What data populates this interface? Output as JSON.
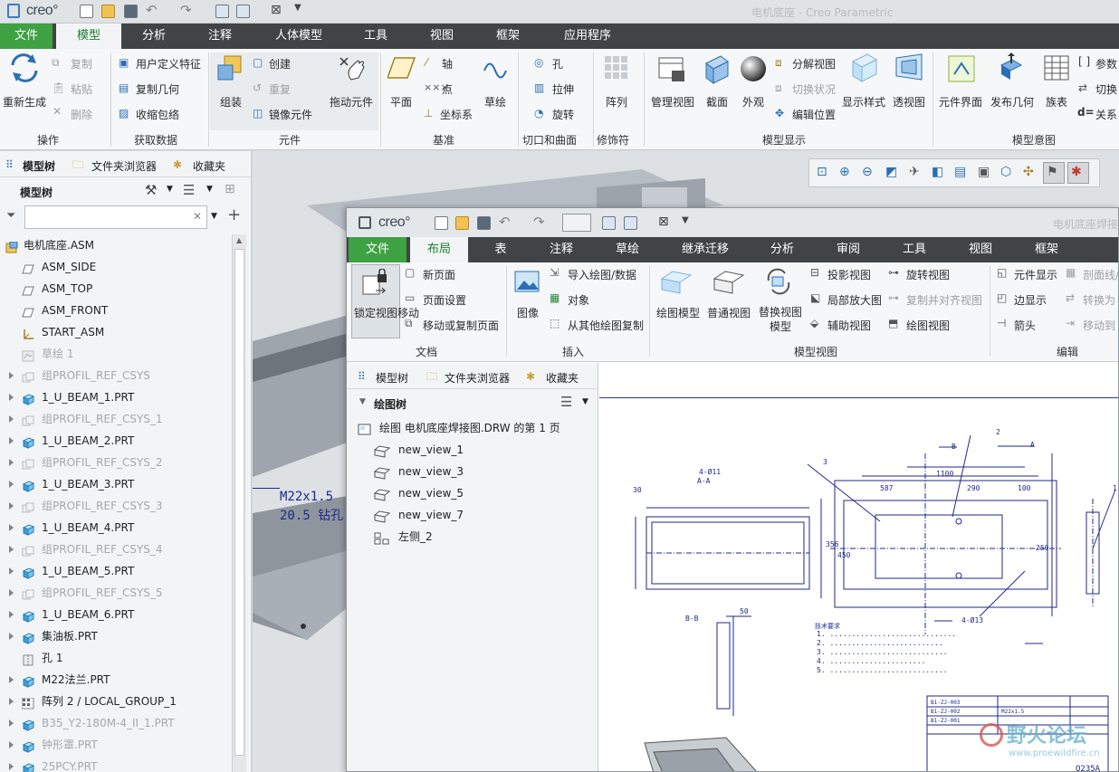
{
  "main": {
    "logo": "creo°",
    "window_title": "电机底座 - Creo Parametric",
    "tabs": [
      "文件",
      "模型",
      "分析",
      "注释",
      "人体模型",
      "工具",
      "视图",
      "框架",
      "应用程序"
    ],
    "ribbon": {
      "regen": "重新生成",
      "copy": "复制",
      "paste": "粘贴",
      "delete": "删除",
      "group_ops": "操作",
      "udf": "用户定义特征",
      "copy_geom": "复制几何",
      "shrinkwrap": "收缩包络",
      "group_getdata": "获取数据",
      "assemble": "组装",
      "create": "创建",
      "repeat": "重复",
      "mirror": "镜像元件",
      "drag": "拖动元件",
      "group_component": "元件",
      "plane": "平面",
      "axis": "轴",
      "point": "点",
      "csys": "坐标系",
      "sketch": "草绘",
      "group_datum": "基准",
      "hole": "孔",
      "extrude": "拉伸",
      "revolve": "旋转",
      "group_cut": "切口和曲面",
      "pattern": "阵列",
      "group_modifier": "修饰符",
      "manage_views": "管理视图",
      "section": "截面",
      "appearance": "外观",
      "explode": "分解视图",
      "toggle_status": "切换状况",
      "edit_position": "编辑位置",
      "display_style": "显示样式",
      "perspective": "透视图",
      "group_display": "模型显示",
      "comp_interface": "元件界面",
      "publish_geom": "发布几何",
      "family_table": "族表",
      "params": "参数",
      "switch": "切换",
      "relations": "关系",
      "group_intent": "模型意图"
    },
    "panel": {
      "tab_tree": "模型树",
      "tab_folder": "文件夹浏览器",
      "tab_fav": "收藏夹",
      "tree_title": "模型树",
      "search_value": "",
      "items": [
        {
          "label": "电机底座.ASM",
          "dim": false,
          "expand": false,
          "indent": 0,
          "icon": "asm-icon"
        },
        {
          "label": "ASM_SIDE",
          "dim": false,
          "expand": false,
          "indent": 1,
          "icon": "datum-plane-icon"
        },
        {
          "label": "ASM_TOP",
          "dim": false,
          "expand": false,
          "indent": 1,
          "icon": "datum-plane-icon"
        },
        {
          "label": "ASM_FRONT",
          "dim": false,
          "expand": false,
          "indent": 1,
          "icon": "datum-plane-icon"
        },
        {
          "label": "START_ASM",
          "dim": false,
          "expand": false,
          "indent": 1,
          "icon": "csys-icon"
        },
        {
          "label": "草绘 1",
          "dim": true,
          "expand": false,
          "indent": 1,
          "icon": "sketch-icon"
        },
        {
          "label": "组PROFIL_REF_CSYS",
          "dim": true,
          "expand": true,
          "indent": 1,
          "icon": "group-icon"
        },
        {
          "label": "1_U_BEAM_1.PRT",
          "dim": false,
          "expand": true,
          "indent": 1,
          "icon": "part-icon"
        },
        {
          "label": "组PROFIL_REF_CSYS_1",
          "dim": true,
          "expand": true,
          "indent": 1,
          "icon": "group-icon"
        },
        {
          "label": "1_U_BEAM_2.PRT",
          "dim": false,
          "expand": true,
          "indent": 1,
          "icon": "part-icon"
        },
        {
          "label": "组PROFIL_REF_CSYS_2",
          "dim": true,
          "expand": true,
          "indent": 1,
          "icon": "group-icon"
        },
        {
          "label": "1_U_BEAM_3.PRT",
          "dim": false,
          "expand": true,
          "indent": 1,
          "icon": "part-icon"
        },
        {
          "label": "组PROFIL_REF_CSYS_3",
          "dim": true,
          "expand": true,
          "indent": 1,
          "icon": "group-icon"
        },
        {
          "label": "1_U_BEAM_4.PRT",
          "dim": false,
          "expand": true,
          "indent": 1,
          "icon": "part-icon"
        },
        {
          "label": "组PROFIL_REF_CSYS_4",
          "dim": true,
          "expand": true,
          "indent": 1,
          "icon": "group-icon"
        },
        {
          "label": "1_U_BEAM_5.PRT",
          "dim": false,
          "expand": true,
          "indent": 1,
          "icon": "part-icon"
        },
        {
          "label": "组PROFIL_REF_CSYS_5",
          "dim": true,
          "expand": true,
          "indent": 1,
          "icon": "group-icon"
        },
        {
          "label": "1_U_BEAM_6.PRT",
          "dim": false,
          "expand": true,
          "indent": 1,
          "icon": "part-icon"
        },
        {
          "label": "集油板.PRT",
          "dim": false,
          "expand": true,
          "indent": 1,
          "icon": "part-icon"
        },
        {
          "label": "孔 1",
          "dim": false,
          "expand": false,
          "indent": 1,
          "icon": "hole-icon"
        },
        {
          "label": "M22法兰.PRT",
          "dim": false,
          "expand": true,
          "indent": 1,
          "icon": "part-icon"
        },
        {
          "label": "阵列 2 / LOCAL_GROUP_1",
          "dim": false,
          "expand": true,
          "indent": 1,
          "icon": "pattern-icon"
        },
        {
          "label": "B35_Y2-180M-4_II_1.PRT",
          "dim": true,
          "expand": true,
          "indent": 1,
          "icon": "part-icon"
        },
        {
          "label": "钟形罩.PRT",
          "dim": true,
          "expand": true,
          "indent": 1,
          "icon": "part-icon"
        },
        {
          "label": "25PCY.PRT",
          "dim": true,
          "expand": true,
          "indent": 1,
          "icon": "part-icon"
        }
      ]
    },
    "viewport_note_line1": "M22x1.5",
    "viewport_note_line2": "20.5 钻孔"
  },
  "drawing": {
    "logo": "creo°",
    "window_title": "电机底座焊接",
    "tabs": [
      "文件",
      "布局",
      "表",
      "注释",
      "草绘",
      "继承迁移",
      "分析",
      "审阅",
      "工具",
      "视图",
      "框架"
    ],
    "ribbon": {
      "lock_move": "锁定视图移动",
      "new_page": "新页面",
      "page_setup": "页面设置",
      "move_copy_page": "移动或复制页面",
      "group_doc": "文档",
      "image": "图像",
      "import_drawing": "导入绘图/数据",
      "object": "对象",
      "copy_from": "从其他绘图复制",
      "group_insert": "插入",
      "drawing_model": "绘图模型",
      "general_view": "普通视图",
      "replace_view": "替换视图模型",
      "projection": "投影视图",
      "detailed": "局部放大图",
      "auxiliary": "辅助视图",
      "revolved": "旋转视图",
      "copy_align": "复制并对齐视图",
      "drawing_view": "绘图视图",
      "group_model_views": "模型视图",
      "comp_display": "元件显示",
      "edge_display": "边显示",
      "arrow": "箭头",
      "section_line": "剖面线/",
      "convert": "转换为",
      "move_to": "移动到",
      "group_edit": "编辑"
    },
    "panel": {
      "tab_tree": "模型树",
      "tab_folder": "文件夹浏览器",
      "tab_fav": "收藏夹",
      "tree_title": "绘图树",
      "items": [
        {
          "label": "绘图 电机底座焊接图.DRW 的第 1 页",
          "icon": "drawing-page-icon"
        },
        {
          "label": "new_view_1",
          "icon": "view-icon"
        },
        {
          "label": "new_view_3",
          "icon": "view-icon"
        },
        {
          "label": "new_view_5",
          "icon": "view-icon"
        },
        {
          "label": "new_view_7",
          "icon": "view-icon"
        },
        {
          "label": "左侧_2",
          "icon": "view-group-icon"
        }
      ]
    },
    "sheet": {
      "dims": [
        "1100",
        "587",
        "290",
        "100",
        "4-Ø11",
        "4-Ø13",
        "30",
        "50",
        "A-A",
        "B-B",
        "356",
        "450",
        "250",
        "A",
        "B",
        "1",
        "2",
        "3"
      ],
      "tech_req_title": "技术要求",
      "watermark": "野火论坛",
      "watermark_url": "www.proewildfire.cn",
      "bom_rows": [
        "B1-ZJ-003",
        "B1-ZJ-002",
        "B1-ZJ-001"
      ],
      "bom_part": "M22x1.5",
      "corner_code": "Q235A"
    }
  }
}
